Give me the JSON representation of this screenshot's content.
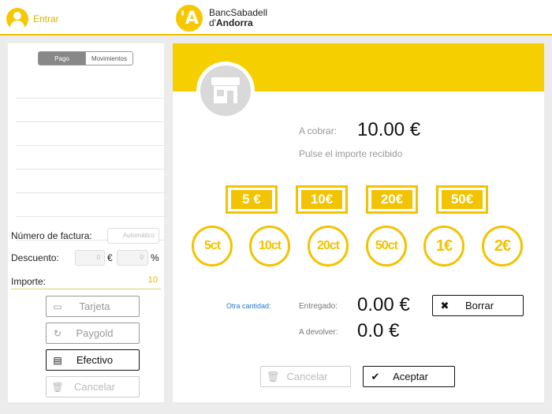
{
  "header": {
    "login_label": "Entrar",
    "brand_line1": "BancSabadell",
    "brand_line2_prefix": "d'",
    "brand_line2_bold": "Andorra",
    "brand_colors": {
      "accent": "#f6c800"
    }
  },
  "left": {
    "tabs": [
      "Pago",
      "Movimientos"
    ],
    "active_tab": "Pago",
    "invoice_label": "Número de factura:",
    "invoice_placeholder": "Automático",
    "discount_label": "Descuento:",
    "discount_amount": "0",
    "discount_currency": "€",
    "discount_percent": "0",
    "discount_percent_symbol": "%",
    "amount_label": "Importe:",
    "amount_value": "10",
    "buttons": {
      "card": "Tarjeta",
      "paygold": "Paygold",
      "cash": "Efectivo",
      "cancel": "Cancelar"
    }
  },
  "right": {
    "charge_label": "A cobrar:",
    "charge_value": "10.00 €",
    "hint": "Pulse el importe recibido",
    "notes": [
      "5 €",
      "10€",
      "20€",
      "50€"
    ],
    "coins": [
      "5ct",
      "10ct",
      "20ct",
      "50ct",
      "1€",
      "2€"
    ],
    "other_amount": "Otra cantidad:",
    "delivered_label": "Entregado:",
    "delivered_value": "0.00 €",
    "change_label": "A devolver:",
    "change_value": "0.0 €",
    "clear_button": "Borrar",
    "cancel_button": "Cancelar",
    "accept_button": "Aceptar"
  }
}
